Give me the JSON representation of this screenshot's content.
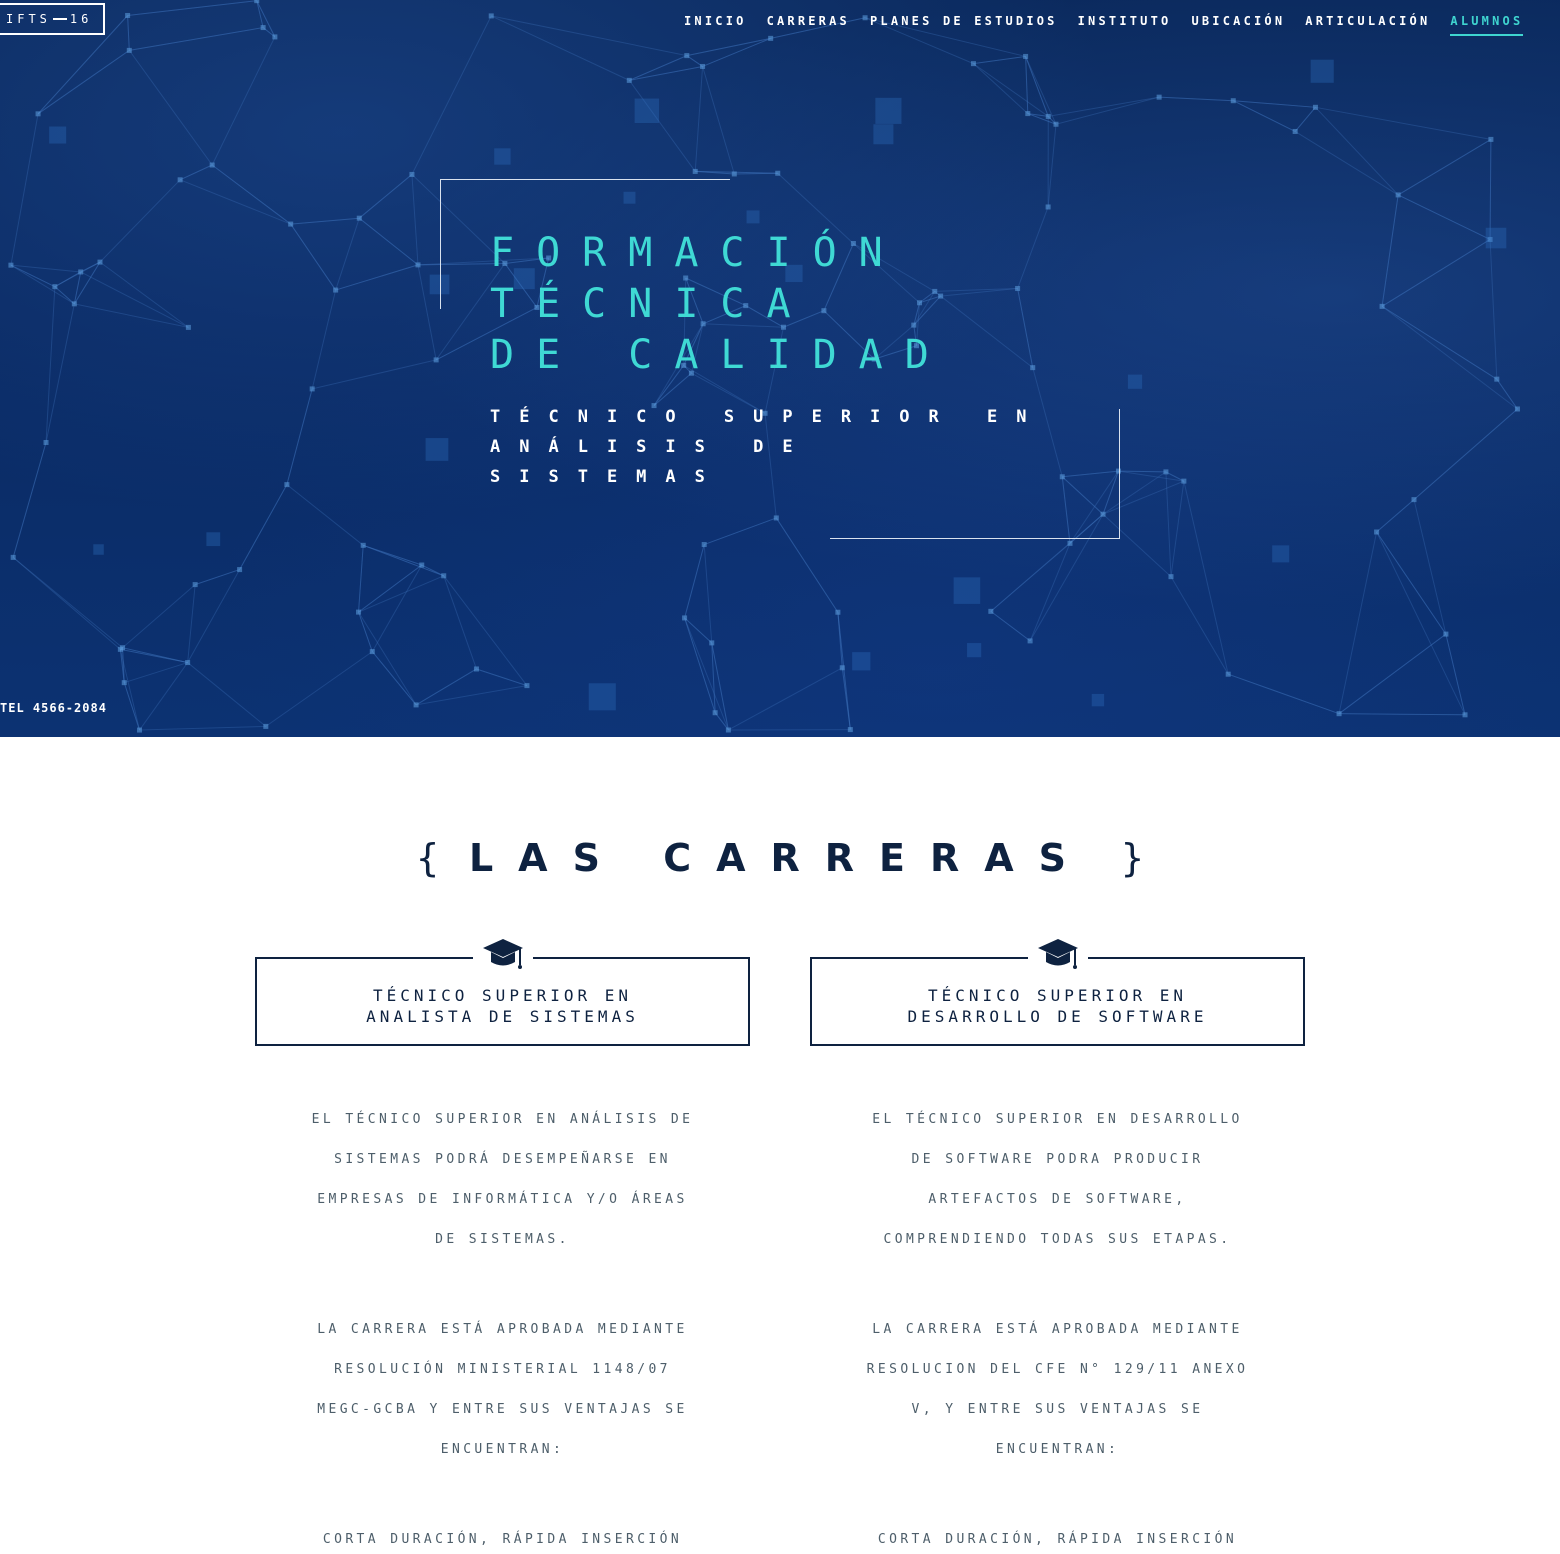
{
  "logo": {
    "left": "IFTS",
    "right": "16"
  },
  "nav": [
    {
      "label": "INICIO"
    },
    {
      "label": "CARRERAS"
    },
    {
      "label": "PLANES DE ESTUDIOS"
    },
    {
      "label": "INSTITUTO"
    },
    {
      "label": "UBICACIÓN"
    },
    {
      "label": "ARTICULACIÓN"
    },
    {
      "label": "ALUMNOS",
      "active": true
    }
  ],
  "hero": {
    "title_lines": [
      "FORMACIÓN",
      "TÉCNICA",
      "DE CALIDAD"
    ],
    "subtitle_lines": [
      "TÉCNICO SUPERIOR EN",
      "ANÁLISIS DE",
      "SISTEMAS"
    ],
    "tel": "TEL 4566-2084"
  },
  "carreras": {
    "title": "LAS CARRERAS",
    "brace_open": "{",
    "brace_close": "}",
    "cards": [
      {
        "icon": "graduation-cap-icon",
        "title_lines": [
          "TÉCNICO SUPERIOR EN",
          "ANALISTA DE SISTEMAS"
        ],
        "paragraphs": [
          [
            "EL TÉCNICO SUPERIOR EN ANÁLISIS DE",
            "SISTEMAS PODRÁ DESEMPEÑARSE EN",
            "EMPRESAS DE INFORMÁTICA Y/O ÁREAS",
            "DE SISTEMAS."
          ],
          [
            "LA CARRERA ESTÁ APROBADA MEDIANTE",
            "RESOLUCIÓN MINISTERIAL 1148/07",
            "MEGC-GCBA Y ENTRE SUS VENTAJAS SE",
            "ENCUENTRAN:"
          ],
          [
            "CORTA DURACIÓN, RÁPIDA INSERCIÓN"
          ]
        ]
      },
      {
        "icon": "graduation-cap-icon",
        "title_lines": [
          "TÉCNICO SUPERIOR EN",
          "DESARROLLO DE SOFTWARE"
        ],
        "paragraphs": [
          [
            "EL TÉCNICO SUPERIOR EN DESARROLLO",
            "DE SOFTWARE PODRA PRODUCIR",
            "ARTEFACTOS DE SOFTWARE,",
            "COMPRENDIENDO TODAS SUS ETAPAS."
          ],
          [
            "LA CARRERA ESTÁ APROBADA MEDIANTE",
            "RESOLUCION DEL CFE N° 129/11 ANEXO",
            "V, Y ENTRE SUS VENTAJAS SE",
            "ENCUENTRAN:"
          ],
          [
            "CORTA DURACIÓN, RÁPIDA INSERCIÓN"
          ]
        ]
      }
    ]
  },
  "colors": {
    "navy": "#0e2240",
    "accent": "#3fd5d0",
    "hero_bg": "#0a2a63",
    "body_text": "#4d5e6a"
  }
}
